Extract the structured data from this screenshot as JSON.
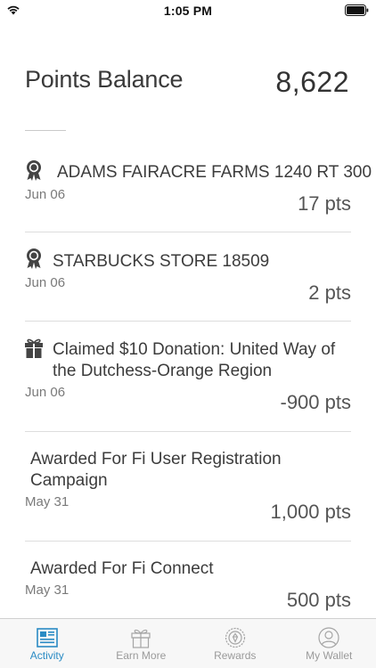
{
  "status_bar": {
    "time": "1:05 PM"
  },
  "balance": {
    "title": "Points Balance",
    "value": "8,622"
  },
  "activities": [
    {
      "title_lines": [
        "ADAMS FAIRACRE FARMS 1240 RT 300"
      ],
      "date": "Jun 06",
      "points": "17 pts",
      "icon": "award-icon"
    },
    {
      "title_lines": [
        "STARBUCKS STORE 18509"
      ],
      "date": "Jun 06",
      "points": "2 pts",
      "icon": "award-icon"
    },
    {
      "title_lines": [
        "Claimed $10 Donation: United Way of",
        "the Dutchess-Orange Region"
      ],
      "date": "Jun 06",
      "points": "-900 pts",
      "icon": "gift-icon"
    },
    {
      "title_lines": [
        "Awarded For Fi User Registration",
        "Campaign"
      ],
      "date": "May 31",
      "points": "1,000 pts",
      "icon": ""
    },
    {
      "title_lines": [
        "Awarded For Fi Connect"
      ],
      "date": "May 31",
      "points": "500 pts",
      "icon": ""
    }
  ],
  "tabs": [
    {
      "label": "Activity",
      "icon": "activity-icon",
      "active": true
    },
    {
      "label": "Earn More",
      "icon": "gift-icon",
      "active": false
    },
    {
      "label": "Rewards",
      "icon": "rewards-icon",
      "active": false
    },
    {
      "label": "My Wallet",
      "icon": "user-icon",
      "active": false
    }
  ],
  "colors": {
    "accent": "#2a8bc4",
    "text": "#3a3a3a",
    "muted": "#7a7a7a",
    "divider": "#dddddd"
  }
}
